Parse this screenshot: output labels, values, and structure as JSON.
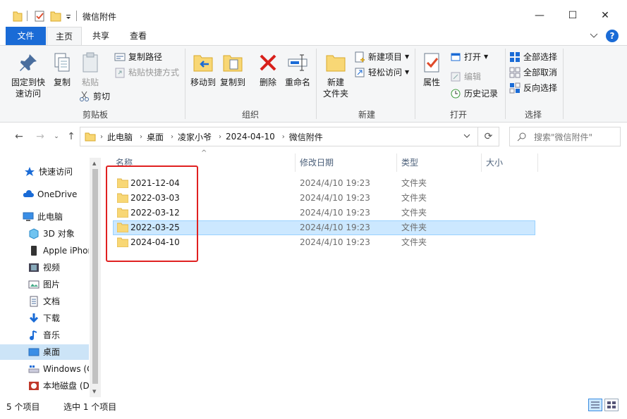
{
  "window": {
    "title": "微信附件",
    "minimize": "—",
    "maximize": "☐",
    "close": "✕"
  },
  "ribbon_tabs": [
    "文件",
    "主页",
    "共享",
    "查看"
  ],
  "ribbon": {
    "clipboard": {
      "pin_label_1": "固定到快",
      "pin_label_2": "速访问",
      "copy": "复制",
      "paste": "粘贴",
      "copy_path": "复制路径",
      "paste_shortcut": "粘贴快捷方式",
      "cut": "剪切",
      "group": "剪贴板"
    },
    "organize": {
      "move_to": "移动到",
      "copy_to": "复制到",
      "delete": "删除",
      "rename": "重命名",
      "group": "组织"
    },
    "new": {
      "new_folder_1": "新建",
      "new_folder_2": "文件夹",
      "new_item": "新建项目",
      "easy_access": "轻松访问",
      "group": "新建"
    },
    "open": {
      "properties": "属性",
      "open": "打开",
      "edit": "编辑",
      "history": "历史记录",
      "group": "打开"
    },
    "select": {
      "select_all": "全部选择",
      "select_none": "全部取消",
      "invert": "反向选择",
      "group": "选择"
    }
  },
  "address": {
    "crumbs": [
      "此电脑",
      "桌面",
      "凌家小爷",
      "2024-04-10",
      "微信附件"
    ],
    "search_placeholder": "搜索\"微信附件\""
  },
  "nav": {
    "items": [
      "快速访问",
      "OneDrive",
      "此电脑",
      "3D 对象",
      "Apple iPhone",
      "视频",
      "图片",
      "文档",
      "下载",
      "音乐",
      "桌面",
      "Windows (C:)",
      "本地磁盘 (D:)"
    ],
    "selected": "桌面"
  },
  "columns": {
    "name": "名称",
    "modified": "修改日期",
    "type": "类型",
    "size": "大小"
  },
  "files": [
    {
      "name": "2021-12-04",
      "modified": "2024/4/10 19:23",
      "type": "文件夹"
    },
    {
      "name": "2022-03-03",
      "modified": "2024/4/10 19:23",
      "type": "文件夹"
    },
    {
      "name": "2022-03-12",
      "modified": "2024/4/10 19:23",
      "type": "文件夹"
    },
    {
      "name": "2022-03-25",
      "modified": "2024/4/10 19:23",
      "type": "文件夹"
    },
    {
      "name": "2024-04-10",
      "modified": "2024/4/10 19:23",
      "type": "文件夹"
    }
  ],
  "status": {
    "count": "5 个项目",
    "selected": "选中 1 个项目"
  },
  "colors": {
    "accent": "#1a6bd6",
    "selection": "#cce8ff",
    "folder": "#f8d775",
    "highlight_box": "#e02020"
  }
}
